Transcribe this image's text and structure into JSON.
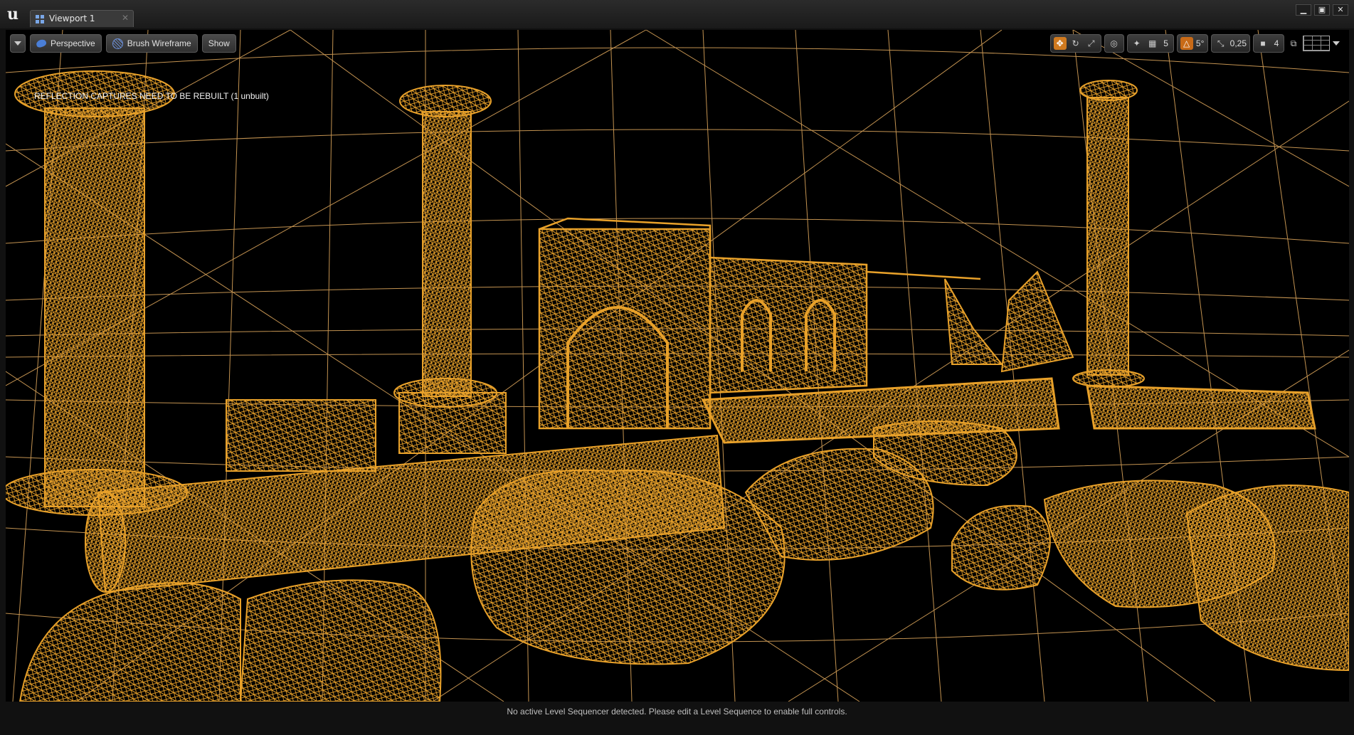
{
  "window": {
    "tab_label": "Viewport 1",
    "controls": {
      "minimize": "▁",
      "maximize": "▣",
      "close": "✕"
    }
  },
  "toolbar_left": {
    "perspective_label": "Perspective",
    "view_mode_label": "Brush Wireframe",
    "show_label": "Show"
  },
  "toolbar_right": {
    "grid_snap_value": "5",
    "rotation_snap_value": "5°",
    "scale_snap_value": "0,25",
    "camera_speed_value": "4"
  },
  "viewport": {
    "warning_text": "REFLECTION CAPTURES NEED TO BE REBUILT (1 unbuilt)",
    "status_text": "No active Level Sequencer detected. Please edit a Level Sequence to enable full controls.",
    "wire_color": "#e8a12a",
    "grid_color": "#d9a35a"
  }
}
